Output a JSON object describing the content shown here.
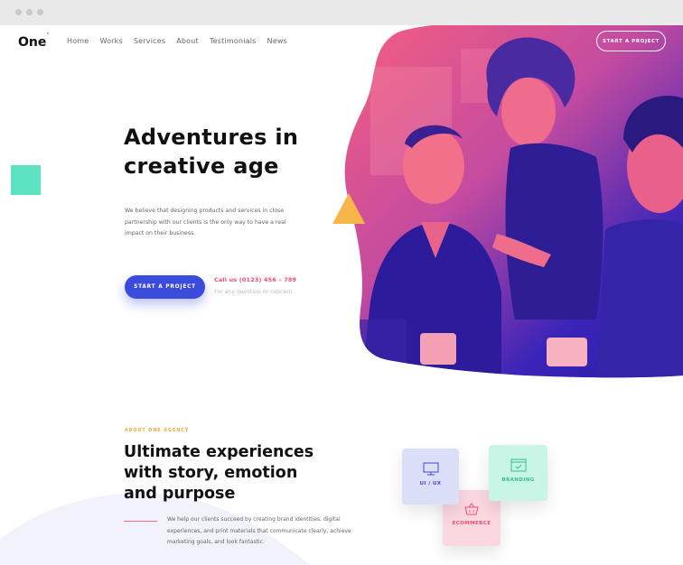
{
  "header": {
    "logo": "One",
    "logo_mark": "•",
    "nav": [
      "Home",
      "Works",
      "Services",
      "About",
      "Testimonials",
      "News"
    ],
    "cta": "START A PROJECT"
  },
  "hero": {
    "title_line1": "Adventures in",
    "title_line2": "creative age",
    "text": "We believe that designing products and services in close partnership with our clients is the only way to have a real impact on their business.",
    "cta": "START A PROJECT",
    "call": "Call us (0123) 456 – 789",
    "call_sub": "For any question or concern"
  },
  "about": {
    "label": "ABOUT ONE AGENCY",
    "title": "Ultimate experiences with story, emotion and purpose",
    "text": "We help our clients succeed by creating brand identities, digital experiences, and print materials that communicate clearly, achieve marketing goals, and look fantastic."
  },
  "services": {
    "uiux": "UI / UX",
    "ecommerce": "ECOMMERCE",
    "branding": "BRANDING"
  },
  "colors": {
    "accent_blue": "#3b4bdb",
    "accent_pink": "#f04e72",
    "accent_green": "#5de3c1",
    "accent_yellow": "#f7b64a"
  },
  "icons": [
    "monitor-icon",
    "basket-icon",
    "browser-check-icon"
  ]
}
